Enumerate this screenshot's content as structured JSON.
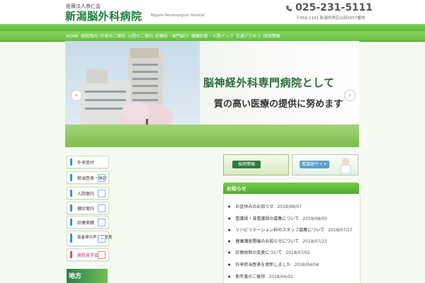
{
  "header": {
    "org": "医療法人恭仁会",
    "hospital_name": "新潟脳外科病院",
    "hospital_name_en": "Niigata Neurosurgical Hospital",
    "phone": "025-231-5111",
    "address": "〒950-1101 新潟市西区山田3057番地"
  },
  "nav": {
    "items": [
      "HOME",
      "病院案内",
      "外来のご案内",
      "入院のご案内",
      "診療科・部門紹介",
      "健康診断・人間ドック",
      "交通アクセス",
      "採用情報"
    ]
  },
  "hero": {
    "tagline_1": "脳神経外科専門病院として",
    "tagline_2": "質の高い医療の提供に努めます",
    "prev": "‹",
    "next": "›"
  },
  "sidebar": {
    "items": [
      {
        "label": "外来受付"
      },
      {
        "label": "担当医表・休診"
      },
      {
        "label": "入院案内"
      },
      {
        "label": "健診案内"
      },
      {
        "label": "診療実績"
      },
      {
        "label": "患者様の声・ご意見"
      },
      {
        "label": "病院見学会"
      }
    ],
    "ad_label": "地方"
  },
  "banners": {
    "recruit": "採用情報",
    "nursing": "看護部サイト"
  },
  "news": {
    "title": "お知らせ",
    "items": [
      {
        "title": "お盆休みのお知らせ",
        "date": "2018/08/07"
      },
      {
        "title": "看護師・准看護師の募集について",
        "date": "2018/08/03"
      },
      {
        "title": "リハビリテーション科のスタッフ募集について",
        "date": "2018/07/27"
      },
      {
        "title": "健康講座開催のお知らせについて",
        "date": "2018/07/23"
      },
      {
        "title": "診療体制の変更について",
        "date": "2018/07/02"
      },
      {
        "title": "外来担当医表を更新しました",
        "date": "2018/04/04"
      },
      {
        "title": "新年度のご挨拶",
        "date": "2018/04/02"
      }
    ]
  }
}
